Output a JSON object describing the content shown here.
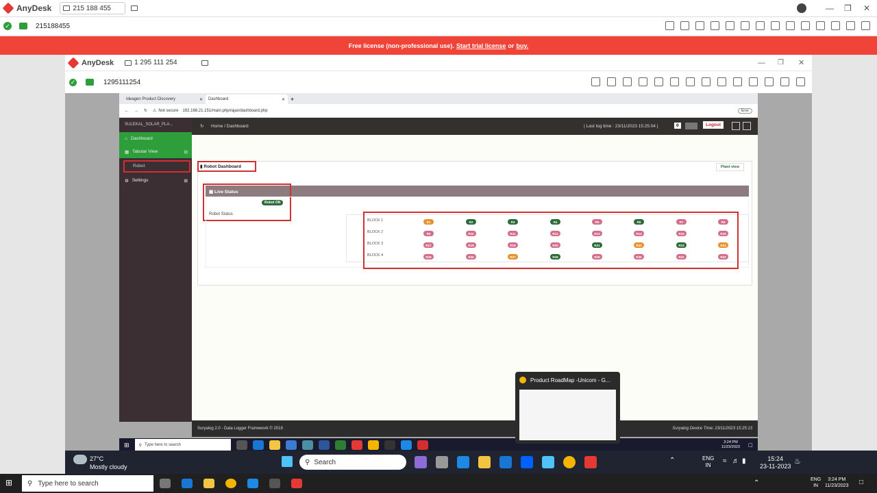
{
  "anydesk_outer": {
    "app_name": "AnyDesk",
    "session_tab": "215 188 455",
    "address": "215188455"
  },
  "license_banner": {
    "text": "Free license (non-professional use).",
    "trial_link": "Start trial license",
    "or": "or",
    "buy_link": "buy."
  },
  "anydesk_inner": {
    "app_name": "AnyDesk",
    "session_tab": "1 295 111 254",
    "address": "1295111254"
  },
  "browser": {
    "tabs": [
      {
        "label": "Ideagen Product Discovery"
      },
      {
        "label": "Dashboard"
      }
    ],
    "security": "Not secure",
    "url": "192.168.21.151/main.php#ajax/dashboard.php",
    "error_label": "Error"
  },
  "app": {
    "plant_name": "SULEKAL_SOLAR_PLA...",
    "sidebar": {
      "dashboard": "Dashboard",
      "tabular_view": "Tabular View",
      "robot": "Robot",
      "settings": "Settings"
    },
    "breadcrumb": {
      "home": "Home",
      "sep": "/",
      "current": "Dashboard"
    },
    "last_log": "| Last log time : 23/11/2023 15:25:04 |",
    "notif_count": "0",
    "logout": "Logout",
    "panel_title": "Robot Dashboard",
    "plant_view": "Plant view",
    "live_status": "Live Status",
    "robot_on": "Robot ON",
    "robot_status": "Robot Status",
    "blocks": [
      {
        "name": "BLOCK 1",
        "robots": [
          {
            "id": "R1",
            "color": "#e8912d"
          },
          {
            "id": "R2",
            "color": "#2e6b3a"
          },
          {
            "id": "R3",
            "color": "#2e6b3a"
          },
          {
            "id": "R4",
            "color": "#2e6b3a"
          },
          {
            "id": "R5",
            "color": "#d36f8a"
          },
          {
            "id": "R6",
            "color": "#2e6b3a"
          },
          {
            "id": "R7",
            "color": "#d36f8a"
          },
          {
            "id": "R8",
            "color": "#d36f8a"
          }
        ]
      },
      {
        "name": "BLOCK 2",
        "robots": [
          {
            "id": "R9",
            "color": "#d36f8a"
          },
          {
            "id": "R10",
            "color": "#d36f8a"
          },
          {
            "id": "R11",
            "color": "#d36f8a"
          },
          {
            "id": "R12",
            "color": "#d36f8a"
          },
          {
            "id": "R13",
            "color": "#d36f8a"
          },
          {
            "id": "R14",
            "color": "#d36f8a"
          },
          {
            "id": "R15",
            "color": "#d36f8a"
          },
          {
            "id": "R16",
            "color": "#d36f8a"
          }
        ]
      },
      {
        "name": "BLOCK 3",
        "robots": [
          {
            "id": "R17",
            "color": "#d36f8a"
          },
          {
            "id": "R18",
            "color": "#d36f8a"
          },
          {
            "id": "R19",
            "color": "#d36f8a"
          },
          {
            "id": "R20",
            "color": "#d36f8a"
          },
          {
            "id": "R21",
            "color": "#2e6b3a"
          },
          {
            "id": "R22",
            "color": "#e8912d"
          },
          {
            "id": "R23",
            "color": "#2e6b3a"
          },
          {
            "id": "R24",
            "color": "#e8912d"
          }
        ]
      },
      {
        "name": "BLOCK 4",
        "robots": [
          {
            "id": "R25",
            "color": "#d36f8a"
          },
          {
            "id": "R26",
            "color": "#d36f8a"
          },
          {
            "id": "R27",
            "color": "#e8912d"
          },
          {
            "id": "R28",
            "color": "#2e6b3a"
          },
          {
            "id": "R29",
            "color": "#d36f8a"
          },
          {
            "id": "R30",
            "color": "#d36f8a"
          },
          {
            "id": "R31",
            "color": "#d36f8a"
          },
          {
            "id": "R32",
            "color": "#d36f8a"
          }
        ]
      }
    ],
    "footer_left": "Suryalog 2.0 - Data Logger Framework © 2019",
    "footer_right": "Suryalog Device Time: 23/11/2023 15:25:13"
  },
  "remote_taskbar": {
    "search_placeholder": "Type here to search",
    "time": "3:24 PM",
    "date": "11/23/2023"
  },
  "preview_popup": {
    "title": "Product RoadMap -Unicom - G..."
  },
  "local_taskbar": {
    "weather_temp": "27°C",
    "weather_desc": "Mostly cloudy",
    "search": "Search",
    "lang": "ENG",
    "region": "IN",
    "time": "15:24",
    "date": "23-11-2023"
  },
  "bottom_taskbar": {
    "search_placeholder": "Type here to search",
    "lang": "ENG",
    "region": "IN",
    "time": "3:24 PM",
    "date": "11/23/2023"
  },
  "colors": {
    "banner": "#f04438",
    "sidebar_active": "#2e9e3a",
    "red_box": "#d32f2f",
    "status_header": "#8c7c80"
  }
}
